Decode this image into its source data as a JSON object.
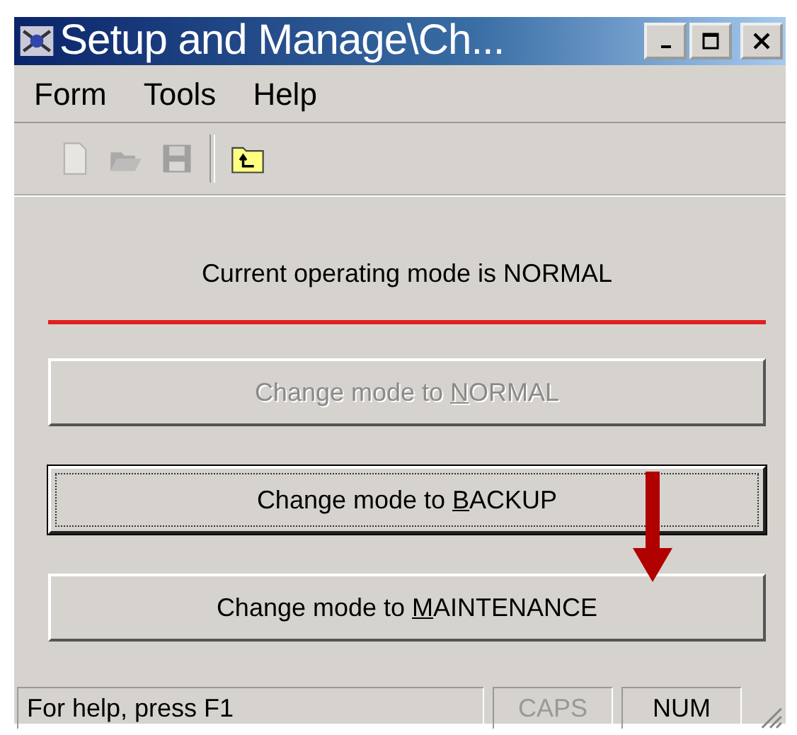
{
  "window": {
    "title": "Setup and Manage\\Ch..."
  },
  "menu": [
    {
      "label": "Form"
    },
    {
      "label": "Tools"
    },
    {
      "label": "Help"
    }
  ],
  "toolbar": [
    {
      "kind": "new",
      "disabled": true
    },
    {
      "kind": "open",
      "disabled": true
    },
    {
      "kind": "save",
      "disabled": true
    },
    {
      "kind": "separator"
    },
    {
      "kind": "up-folder",
      "disabled": false
    }
  ],
  "status_message": "Current operating mode is NORMAL",
  "buttons": [
    {
      "before": "Change mode to ",
      "mnemonic": "N",
      "after": "ORMAL",
      "disabled": true,
      "default": false
    },
    {
      "before": "Change mode to ",
      "mnemonic": "B",
      "after": "ACKUP",
      "disabled": false,
      "default": true
    },
    {
      "before": "Change mode to ",
      "mnemonic": "M",
      "after": "AINTENANCE",
      "disabled": false,
      "default": false
    }
  ],
  "status_bar": {
    "text": "For help, press F1",
    "indicators": [
      {
        "label": "CAPS",
        "on": false
      },
      {
        "label": "NUM",
        "on": true
      }
    ]
  }
}
